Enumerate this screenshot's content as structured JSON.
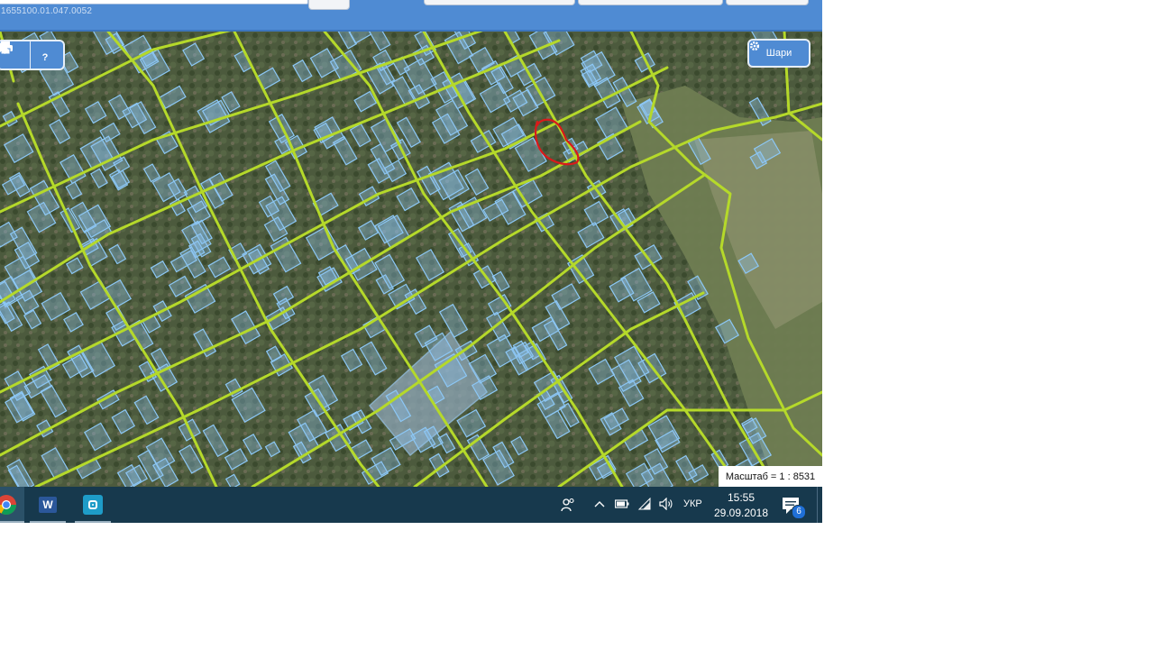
{
  "toolbar": {
    "cadastral_number": "1655100.01.047.0052",
    "search_placeholder": ""
  },
  "map": {
    "print_button": {
      "icon": "print-icon"
    },
    "info_button": {
      "icon": "pointer-help-icon",
      "label": "?"
    },
    "layers_button": {
      "icon": "gear-icon",
      "label": "Шари"
    },
    "scale_text": "Масштаб = 1 : 8531",
    "colors": {
      "parcel_stroke": "#7fb6e8",
      "parcel_fill": "#8cc3f0",
      "road": "#b5d92a",
      "annotation": "#d91a1a"
    }
  },
  "taskbar": {
    "apps": [
      {
        "name": "chrome",
        "icon": "chrome-icon"
      },
      {
        "name": "word",
        "icon": "word-icon",
        "label": "W"
      },
      {
        "name": "camera",
        "icon": "camera-icon"
      }
    ],
    "tray": {
      "language": "УКР",
      "time": "15:55",
      "date": "29.09.2018",
      "notification_count": "6"
    }
  }
}
